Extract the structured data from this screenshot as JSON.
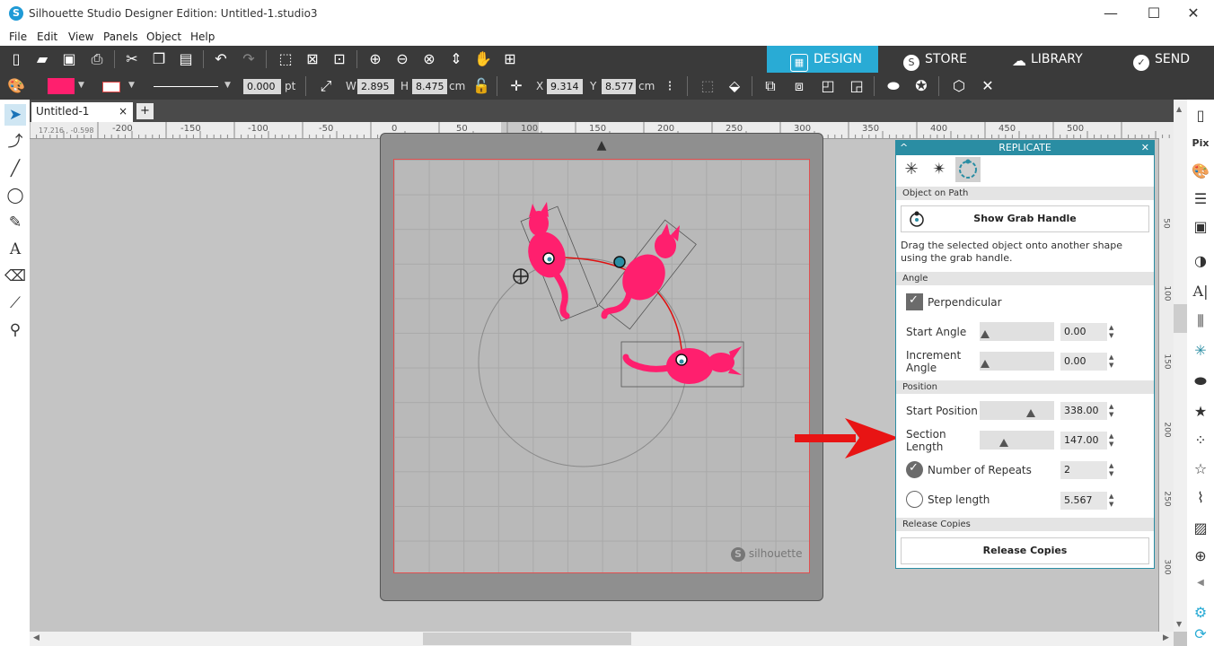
{
  "window": {
    "title": "Silhouette Studio Designer Edition: Untitled-1.studio3",
    "minimize": "—",
    "maximize": "☐",
    "close": "✕"
  },
  "menu": [
    "File",
    "Edit",
    "View",
    "Panels",
    "Object",
    "Help"
  ],
  "nav_tabs": {
    "design": "DESIGN",
    "store": "STORE",
    "library": "LIBRARY",
    "send": "SEND"
  },
  "toolbar2": {
    "line_width": "0.000",
    "line_unit": "pt",
    "w_label": "W",
    "w_value": "2.895",
    "h_label": "H",
    "h_value": "8.475",
    "size_unit": "cm",
    "x_label": "X",
    "x_value": "9.314",
    "y_label": "Y",
    "y_value": "8.577",
    "pos_unit": "cm"
  },
  "document": {
    "tab_name": "Untitled-1",
    "tab_close": "×",
    "add_tab": "+"
  },
  "ruler": {
    "coords": "17.216 , -0.598",
    "h_labels": [
      "-200",
      "-150",
      "-100",
      "-50",
      "0",
      "50",
      "100",
      "150",
      "200",
      "250",
      "300",
      "350",
      "400",
      "450",
      "500"
    ],
    "v_labels": [
      "50",
      "100",
      "150",
      "200",
      "250",
      "300"
    ]
  },
  "mat": {
    "brand": "silhouette"
  },
  "replicate": {
    "title": "REPLICATE",
    "sections": {
      "object_on_path": "Object on Path",
      "angle": "Angle",
      "position": "Position",
      "release": "Release Copies"
    },
    "show_grab_handle": "Show Grab Handle",
    "help_text": "Drag the selected object onto another shape using the grab handle.",
    "perpendicular": "Perpendicular",
    "start_angle_label": "Start Angle",
    "start_angle_value": "0.00",
    "increment_angle_label": "Increment Angle",
    "increment_angle_value": "0.00",
    "start_position_label": "Start Position",
    "start_position_value": "338.00",
    "section_length_label": "Section Length",
    "section_length_value": "147.00",
    "number_of_repeats_label": "Number of Repeats",
    "number_of_repeats_value": "2",
    "step_length_label": "Step length",
    "step_length_value": "5.567",
    "release_copies_button": "Release Copies",
    "perpendicular_checked": true,
    "mode": "number_of_repeats"
  },
  "colors": {
    "fill": "#ff1f6e",
    "accent": "#2a8da3",
    "design_tab": "#29abd5",
    "annotation_arrow": "#e81414"
  }
}
